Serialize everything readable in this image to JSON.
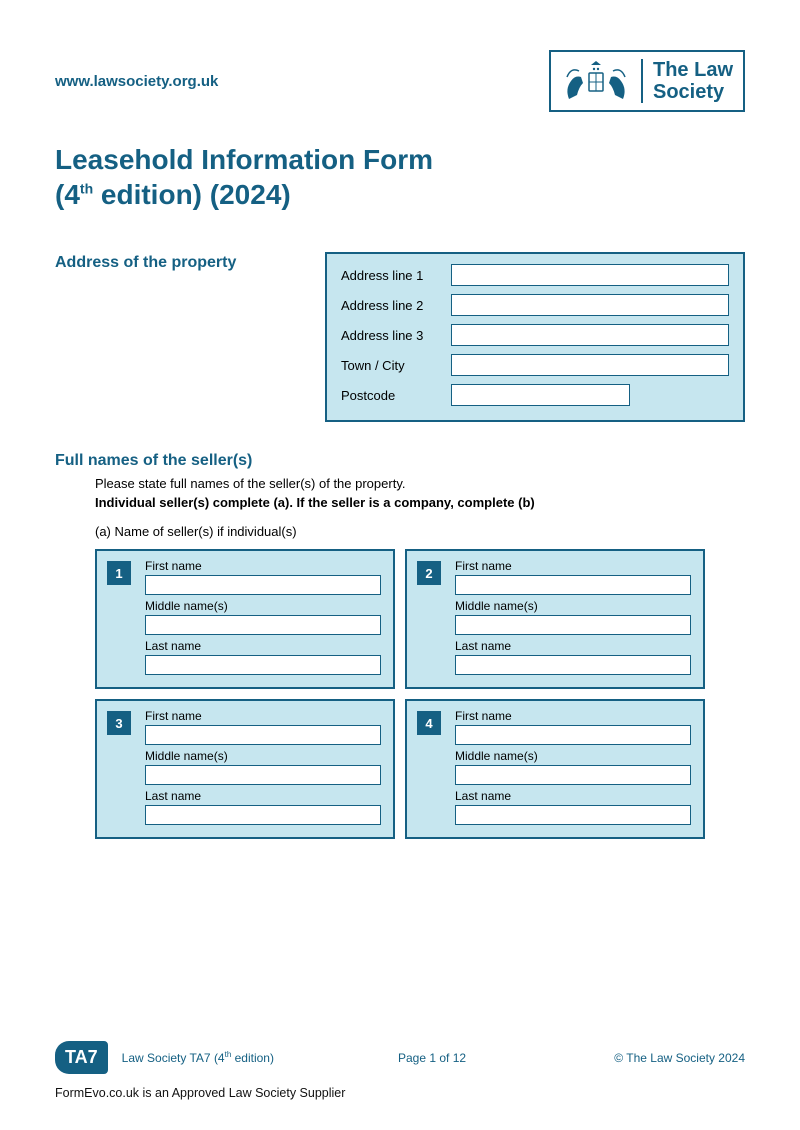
{
  "header": {
    "url": "www.lawsociety.org.uk",
    "logo_text_line1": "The Law",
    "logo_text_line2": "Society"
  },
  "title": {
    "line1": "Leasehold Information Form",
    "line2_pre": "(4",
    "line2_sup": "th",
    "line2_post": " edition) (2024)"
  },
  "address": {
    "section_label": "Address of the property",
    "fields": {
      "line1": "Address line 1",
      "line2": "Address line 2",
      "line3": "Address line 3",
      "town": "Town / City",
      "postcode": "Postcode"
    }
  },
  "sellers": {
    "section_label": "Full names of the seller(s)",
    "instruction1": "Please state full names of the seller(s) of the property.",
    "instruction2": "Individual seller(s) complete (a). If the seller is a company, complete (b)",
    "sub_a": "(a) Name of seller(s) if individual(s)",
    "field_labels": {
      "first": "First name",
      "middle": "Middle name(s)",
      "last": "Last name"
    },
    "boxes": [
      "1",
      "2",
      "3",
      "4"
    ]
  },
  "footer": {
    "badge": "TA7",
    "mid_pre": "Law Society TA7 (4",
    "mid_sup": "th",
    "mid_post": " edition)",
    "page": "Page 1 of 12",
    "copy": "© The Law Society 2024",
    "supplier": "FormEvo.co.uk is an Approved Law Society Supplier"
  }
}
